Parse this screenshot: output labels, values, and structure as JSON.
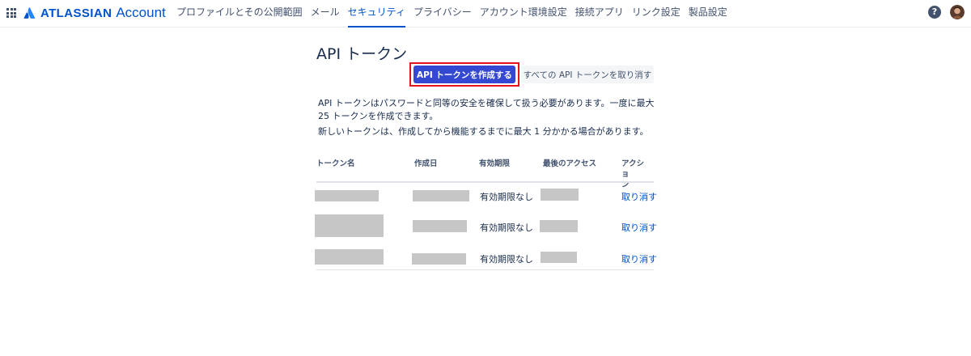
{
  "header": {
    "brand_name": "ATLASSIAN",
    "brand_product": "Account",
    "nav": [
      {
        "label": "プロファイルとその公開範囲",
        "active": false
      },
      {
        "label": "メール",
        "active": false
      },
      {
        "label": "セキュリティ",
        "active": true
      },
      {
        "label": "プライバシー",
        "active": false
      },
      {
        "label": "アカウント環境設定",
        "active": false
      },
      {
        "label": "接続アプリ",
        "active": false
      },
      {
        "label": "リンク設定",
        "active": false
      },
      {
        "label": "製品設定",
        "active": false
      }
    ],
    "help_glyph": "?"
  },
  "icons": {
    "app_switcher": "grid-icon",
    "brand_logo": "atlassian-logo-icon",
    "help": "help-icon",
    "avatar": "user-avatar"
  },
  "colors": {
    "brand": "#0052cc",
    "primary_button": "#3548d1",
    "highlight": "#e5131d",
    "redaction": "#c6c6c6"
  },
  "page": {
    "title": "API トークン",
    "create_button": "API トークンを作成する",
    "revoke_all_button": "すべての API トークンを取り消す",
    "description_1": "API トークンはパスワードと同等の安全を確保して扱う必要があります。一度に最大 25 トークンを作成できます。",
    "description_2": "新しいトークンは、作成してから機能するまでに最大 1 分かかる場合があります。"
  },
  "table": {
    "columns": [
      "トークン名",
      "作成日",
      "有効期限",
      "最後のアクセス",
      "アクショ\nン"
    ],
    "rows": [
      {
        "expiry": "有効期限なし",
        "action": "取り消す"
      },
      {
        "expiry": "有効期限なし",
        "action": "取り消す"
      },
      {
        "expiry": "有効期限なし",
        "action": "取り消す"
      }
    ]
  }
}
